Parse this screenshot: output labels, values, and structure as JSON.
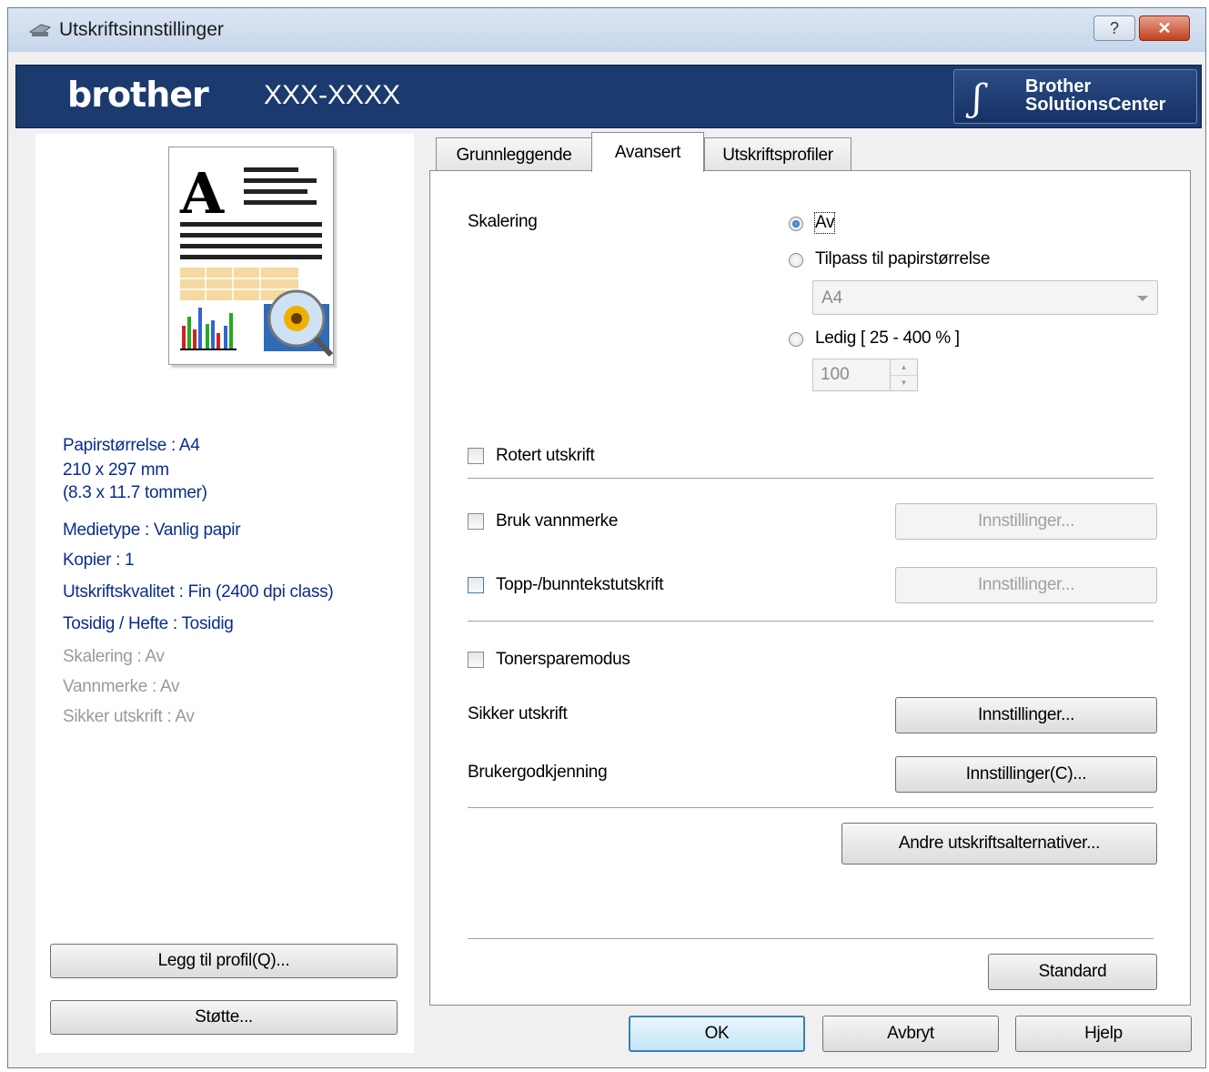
{
  "window": {
    "title": "Utskriftsinnstillinger",
    "help_label": "?",
    "close_label": "✕"
  },
  "banner": {
    "brand": "brother",
    "model": "XXX-XXXX",
    "solutions_line1": "Brother",
    "solutions_line2": "SolutionsCenter"
  },
  "summary": {
    "paper_size": "Papirstørrelse : A4",
    "dimensions_mm": "210 x 297 mm",
    "dimensions_in": "(8.3 x 11.7 tommer)",
    "media_type": "Medietype : Vanlig papir",
    "copies": "Kopier : 1",
    "quality": "Utskriftskvalitet : Fin (2400 dpi class)",
    "duplex": "Tosidig / Hefte : Tosidig",
    "scaling": "Skalering : Av",
    "watermark": "Vannmerke : Av",
    "secure": "Sikker utskrift : Av"
  },
  "left_buttons": {
    "add_profile": "Legg til profil(Q)...",
    "support": "Støtte..."
  },
  "tabs": [
    {
      "label": "Grunnleggende"
    },
    {
      "label": "Avansert"
    },
    {
      "label": "Utskriftsprofiler"
    }
  ],
  "advanced": {
    "scaling_label": "Skalering",
    "opt_off": "Av",
    "opt_fit": "Tilpass til papirstørrelse",
    "fit_size_value": "A4",
    "opt_free": "Ledig [ 25 - 400 % ]",
    "free_value": "100",
    "rotate_label": "Rotert utskrift",
    "watermark_label": "Bruk vannmerke",
    "header_footer_label": "Topp-/bunntekstutskrift",
    "toner_save_label": "Tonersparemodus",
    "secure_print_label": "Sikker utskrift",
    "user_auth_label": "Brukergodkjenning",
    "settings_btn": "Innstillinger...",
    "settings_c_btn": "Innstillinger(C)...",
    "other_options_btn": "Andre utskriftsalternativer...",
    "standard_btn": "Standard"
  },
  "footer": {
    "ok": "OK",
    "cancel": "Avbryt",
    "help": "Hjelp"
  }
}
